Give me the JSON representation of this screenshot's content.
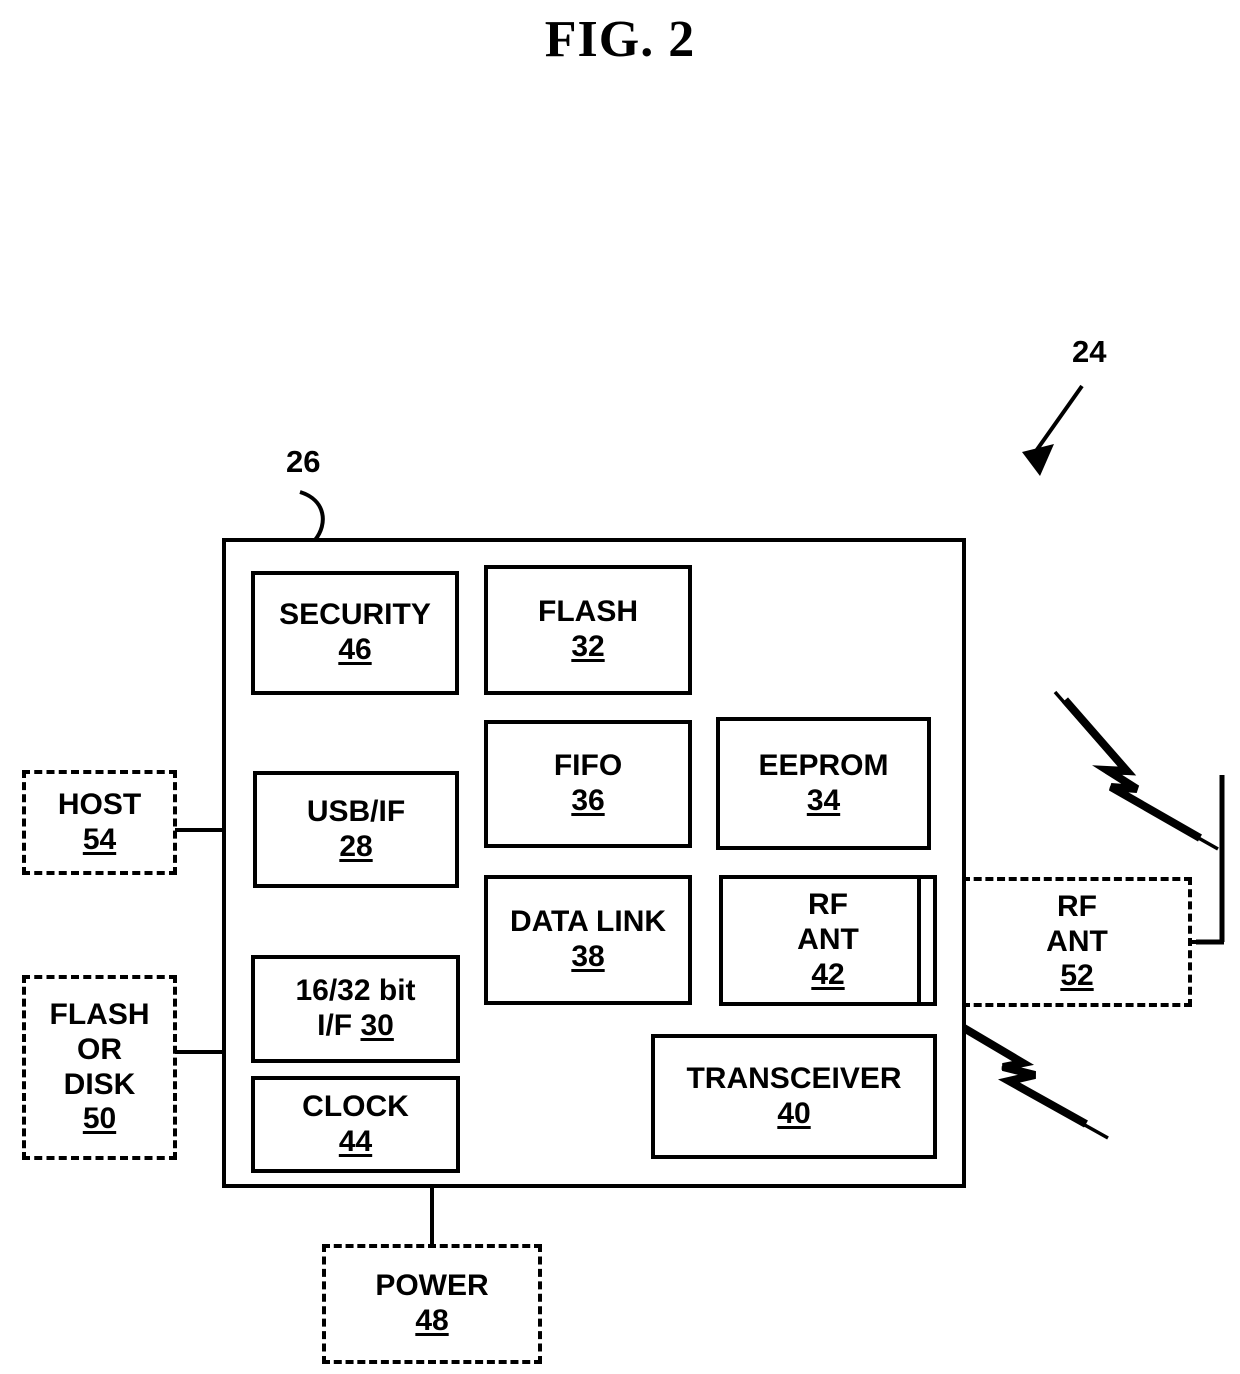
{
  "figure": {
    "title": "FIG. 2",
    "system_ref": "24",
    "chip_ref": "26"
  },
  "chip_blocks": [
    {
      "id": "security",
      "lines": [
        "SECURITY"
      ],
      "ref": "46"
    },
    {
      "id": "flash",
      "lines": [
        "FLASH"
      ],
      "ref": "32"
    },
    {
      "id": "usb_if",
      "lines": [
        "USB/IF"
      ],
      "ref": "28"
    },
    {
      "id": "fifo",
      "lines": [
        "FIFO"
      ],
      "ref": "36"
    },
    {
      "id": "eeprom",
      "lines": [
        "EEPROM"
      ],
      "ref": "34"
    },
    {
      "id": "bit_if",
      "lines": [
        "16/32 bit"
      ],
      "inline_ref_line": "I/F ",
      "ref": "30"
    },
    {
      "id": "data_link",
      "lines": [
        "DATA LINK"
      ],
      "ref": "38"
    },
    {
      "id": "rf_ant_int",
      "lines": [
        "RF",
        "ANT"
      ],
      "ref": "42"
    },
    {
      "id": "clock",
      "lines": [
        "CLOCK"
      ],
      "ref": "44"
    },
    {
      "id": "transceiver",
      "lines": [
        "TRANSCEIVER"
      ],
      "ref": "40"
    }
  ],
  "external_blocks": [
    {
      "id": "host",
      "lines": [
        "HOST"
      ],
      "ref": "54"
    },
    {
      "id": "flash_disk",
      "lines": [
        "FLASH",
        "OR",
        "DISK"
      ],
      "ref": "50"
    },
    {
      "id": "power",
      "lines": [
        "POWER"
      ],
      "ref": "48"
    },
    {
      "id": "rf_ant_ext",
      "lines": [
        "RF",
        "ANT"
      ],
      "ref": "52"
    }
  ],
  "icons": {
    "antenna": "antenna-icon",
    "rf_signal_upper": "rf-signal-bolt-icon",
    "rf_signal_lower": "rf-signal-bolt-icon",
    "lead_arrow": "leader-arrow-icon",
    "lead_hook": "leader-hook-icon"
  },
  "colors": {
    "ink": "#000000",
    "paper": "#ffffff"
  }
}
